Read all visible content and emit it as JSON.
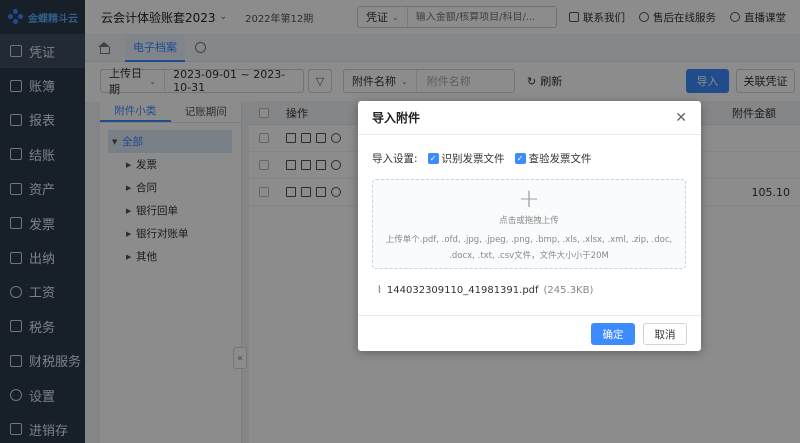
{
  "logo": {
    "text": "金蝶精斗云"
  },
  "sidebar": {
    "items": [
      {
        "label": "凭证",
        "active": true
      },
      {
        "label": "账簿"
      },
      {
        "label": "报表"
      },
      {
        "label": "结账"
      },
      {
        "label": "资产"
      },
      {
        "label": "发票"
      },
      {
        "label": "出纳"
      },
      {
        "label": "工资"
      },
      {
        "label": "税务"
      },
      {
        "label": "财税服务"
      },
      {
        "label": "设置"
      },
      {
        "label": "进销存"
      }
    ]
  },
  "topbar": {
    "company": "云会计体验账套2023",
    "period": "2022年第12期",
    "search_type": "凭证",
    "search_placeholder": "输入金额/核算项目/科目/...",
    "contact": "联系我们",
    "service": "售后在线服务",
    "live": "直播课堂"
  },
  "tabs": {
    "active": "电子档案"
  },
  "filter": {
    "date_label": "上传日期",
    "date_range": "2023-09-01 ~ 2023-10-31",
    "name_label": "附件名称",
    "name_placeholder": "附件名称",
    "refresh": "刷新",
    "import": "导入",
    "link_voucher": "关联凭证"
  },
  "leftpanel": {
    "tabs": [
      "附件小类",
      "记账期间"
    ],
    "root": "全部",
    "children": [
      "发票",
      "合同",
      "银行回单",
      "银行对账单",
      "其他"
    ]
  },
  "table": {
    "col_op": "操作",
    "col_amount": "附件金额",
    "rows": [
      {
        "amount": ""
      },
      {
        "amount": ""
      },
      {
        "amount": "105.10"
      }
    ]
  },
  "modal": {
    "title": "导入附件",
    "settings_label": "导入设置:",
    "opt1": "识别发票文件",
    "opt2": "查验发票文件",
    "drop_title": "点击或拖拽上传",
    "drop_hint": "上传单个.pdf, .ofd, .jpg, .jpeg, .png, .bmp, .xls, .xlsx, .xml, .zip, .doc, .docx, .txt, .csv文件，文件大小小于20M",
    "file_name": "144032309110_41981391.pdf",
    "file_size": "(245.3KB)",
    "ok": "确定",
    "cancel": "取消"
  }
}
